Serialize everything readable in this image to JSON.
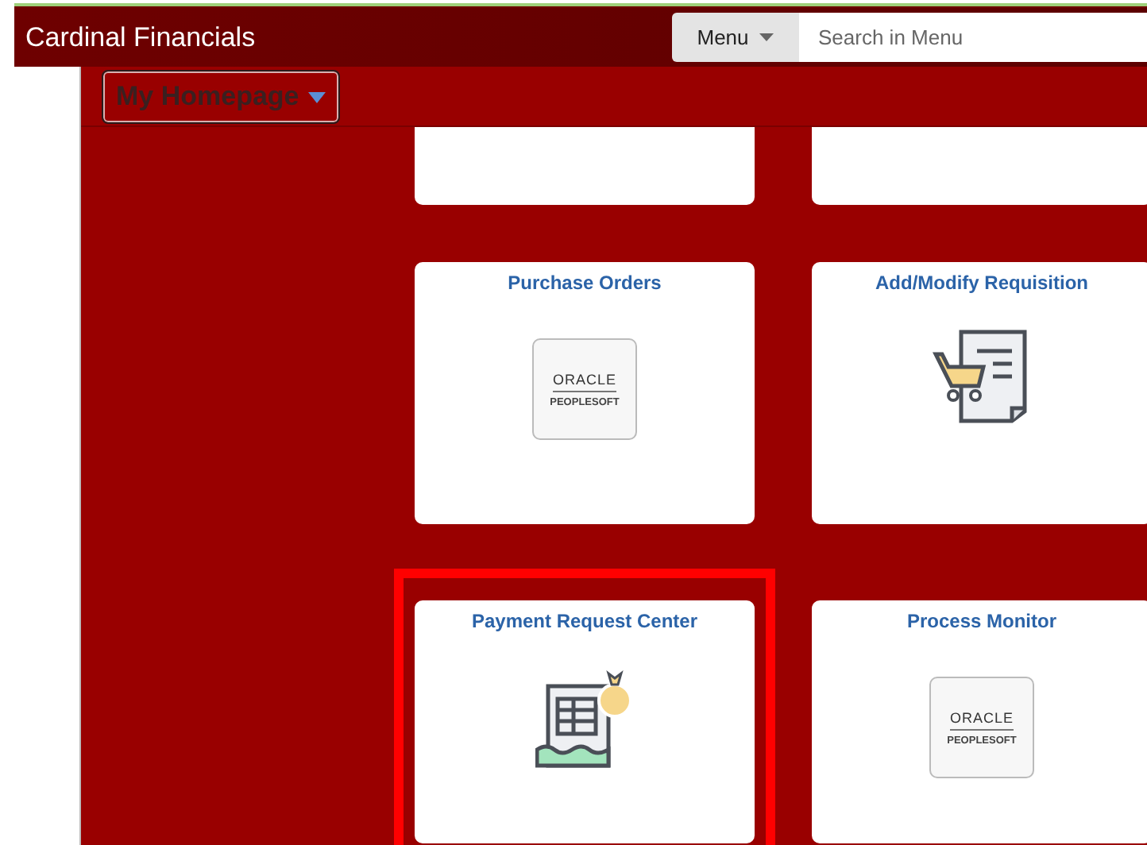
{
  "header": {
    "title": "Cardinal Financials",
    "menu_button": "Menu",
    "search": {
      "placeholder": "Search in Menu"
    }
  },
  "homepage_selector": {
    "label": "My Homepage"
  },
  "tiles": [
    {
      "kind": "blank",
      "highlighted": false
    },
    {
      "kind": "blank",
      "highlighted": false
    },
    {
      "kind": "oracle",
      "title": "Purchase Orders",
      "logo_top": "ORACLE",
      "logo_bottom": "PEOPLESOFT",
      "highlighted": false
    },
    {
      "kind": "cart",
      "title": "Add/Modify Requisition",
      "highlighted": false
    },
    {
      "kind": "payment",
      "title": "Payment Request Center",
      "highlighted": true
    },
    {
      "kind": "oracle",
      "title": "Process Monitor",
      "logo_top": "ORACLE",
      "logo_bottom": "PEOPLESOFT",
      "highlighted": false
    }
  ]
}
